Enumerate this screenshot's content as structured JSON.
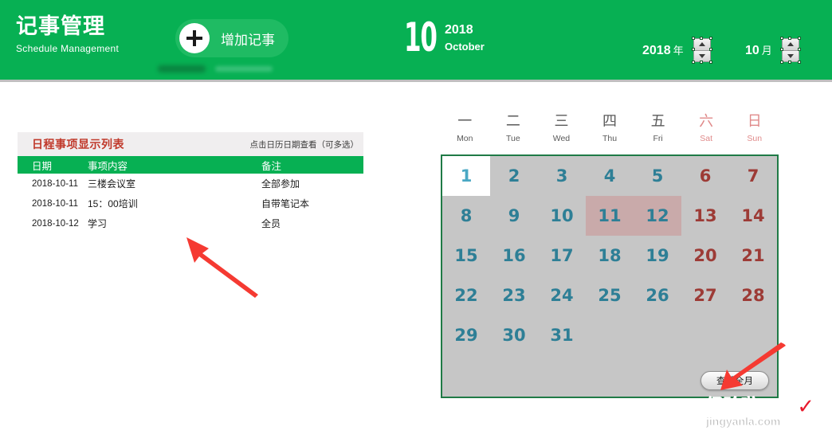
{
  "header": {
    "title_cn": "记事管理",
    "title_en": "Schedule Management",
    "add_button_label": "增加记事",
    "plus_icon": "plus-icon",
    "month_number": "10",
    "year_big": "2018",
    "month_name_en": "October",
    "year_selector": {
      "value": "2018",
      "unit": "年"
    },
    "month_selector": {
      "value": "10",
      "unit": "月"
    },
    "accent_color": "#07b053"
  },
  "list_panel": {
    "title": "日程事项显示列表",
    "hint": "点击日历日期查看（可多选）",
    "columns": [
      "日期",
      "事项内容",
      "备注"
    ],
    "rows": [
      {
        "date": "2018-10-11",
        "content": "三楼会议室",
        "remark": "全部参加"
      },
      {
        "date": "2018-10-11",
        "content": "15：00培训",
        "remark": "自带笔记本"
      },
      {
        "date": "2018-10-12",
        "content": "学习",
        "remark": "全员"
      }
    ],
    "title_color": "#c0392b",
    "header_bg": "#07b053"
  },
  "calendar": {
    "weekdays": [
      {
        "cn": "一",
        "en": "Mon",
        "weekend": false
      },
      {
        "cn": "二",
        "en": "Tue",
        "weekend": false
      },
      {
        "cn": "三",
        "en": "Wed",
        "weekend": false
      },
      {
        "cn": "四",
        "en": "Thu",
        "weekend": false
      },
      {
        "cn": "五",
        "en": "Fri",
        "weekend": false
      },
      {
        "cn": "六",
        "en": "Sat",
        "weekend": true
      },
      {
        "cn": "日",
        "en": "Sun",
        "weekend": true
      }
    ],
    "days": [
      {
        "n": "1",
        "weekend": false,
        "today": true,
        "marked": false
      },
      {
        "n": "2",
        "weekend": false,
        "today": false,
        "marked": false
      },
      {
        "n": "3",
        "weekend": false,
        "today": false,
        "marked": false
      },
      {
        "n": "4",
        "weekend": false,
        "today": false,
        "marked": false
      },
      {
        "n": "5",
        "weekend": false,
        "today": false,
        "marked": false
      },
      {
        "n": "6",
        "weekend": true,
        "today": false,
        "marked": false
      },
      {
        "n": "7",
        "weekend": true,
        "today": false,
        "marked": false
      },
      {
        "n": "8",
        "weekend": false,
        "today": false,
        "marked": false
      },
      {
        "n": "9",
        "weekend": false,
        "today": false,
        "marked": false
      },
      {
        "n": "10",
        "weekend": false,
        "today": false,
        "marked": false
      },
      {
        "n": "11",
        "weekend": false,
        "today": false,
        "marked": true
      },
      {
        "n": "12",
        "weekend": false,
        "today": false,
        "marked": true
      },
      {
        "n": "13",
        "weekend": true,
        "today": false,
        "marked": false
      },
      {
        "n": "14",
        "weekend": true,
        "today": false,
        "marked": false
      },
      {
        "n": "15",
        "weekend": false,
        "today": false,
        "marked": false
      },
      {
        "n": "16",
        "weekend": false,
        "today": false,
        "marked": false
      },
      {
        "n": "17",
        "weekend": false,
        "today": false,
        "marked": false
      },
      {
        "n": "18",
        "weekend": false,
        "today": false,
        "marked": false
      },
      {
        "n": "19",
        "weekend": false,
        "today": false,
        "marked": false
      },
      {
        "n": "20",
        "weekend": true,
        "today": false,
        "marked": false
      },
      {
        "n": "21",
        "weekend": true,
        "today": false,
        "marked": false
      },
      {
        "n": "22",
        "weekend": false,
        "today": false,
        "marked": false
      },
      {
        "n": "23",
        "weekend": false,
        "today": false,
        "marked": false
      },
      {
        "n": "24",
        "weekend": false,
        "today": false,
        "marked": false
      },
      {
        "n": "25",
        "weekend": false,
        "today": false,
        "marked": false
      },
      {
        "n": "26",
        "weekend": false,
        "today": false,
        "marked": false
      },
      {
        "n": "27",
        "weekend": true,
        "today": false,
        "marked": false
      },
      {
        "n": "28",
        "weekend": true,
        "today": false,
        "marked": false
      },
      {
        "n": "29",
        "weekend": false,
        "today": false,
        "marked": false
      },
      {
        "n": "30",
        "weekend": false,
        "today": false,
        "marked": false
      },
      {
        "n": "31",
        "weekend": false,
        "today": false,
        "marked": false
      },
      {
        "n": "",
        "weekend": false,
        "today": false,
        "marked": false,
        "empty": true
      },
      {
        "n": "",
        "weekend": false,
        "today": false,
        "marked": false,
        "empty": true
      },
      {
        "n": "",
        "weekend": false,
        "today": false,
        "marked": false,
        "empty": true
      },
      {
        "n": "",
        "weekend": false,
        "today": false,
        "marked": false,
        "empty": true
      },
      {
        "n": "",
        "weekend": false,
        "today": false,
        "marked": false,
        "empty": true
      },
      {
        "n": "",
        "weekend": false,
        "today": false,
        "marked": false,
        "empty": true
      },
      {
        "n": "",
        "weekend": false,
        "today": false,
        "marked": false,
        "empty": true
      },
      {
        "n": "",
        "weekend": false,
        "today": false,
        "marked": false,
        "empty": true
      },
      {
        "n": "",
        "weekend": false,
        "today": false,
        "marked": false,
        "empty": true
      },
      {
        "n": "",
        "weekend": false,
        "today": false,
        "marked": false,
        "empty": true
      },
      {
        "n": "",
        "weekend": false,
        "today": false,
        "marked": false,
        "empty": true
      }
    ],
    "view_month_button": "查看全月",
    "border_color": "#1f7a46",
    "cell_bg": "#c6c6c6",
    "marked_color": "#c9aaaa",
    "weekday_color": "#2e7f96",
    "weekend_color": "#9d3b36"
  },
  "annotations": {
    "arrow_color": "#f53a32",
    "arrow_left_name": "red-arrow-pointing-to-list",
    "arrow_right_name": "red-arrow-pointing-to-view-month-button"
  },
  "watermark": {
    "brand_cn": "经验啦",
    "url": "jingyanla.com",
    "check_mark": "✓"
  }
}
